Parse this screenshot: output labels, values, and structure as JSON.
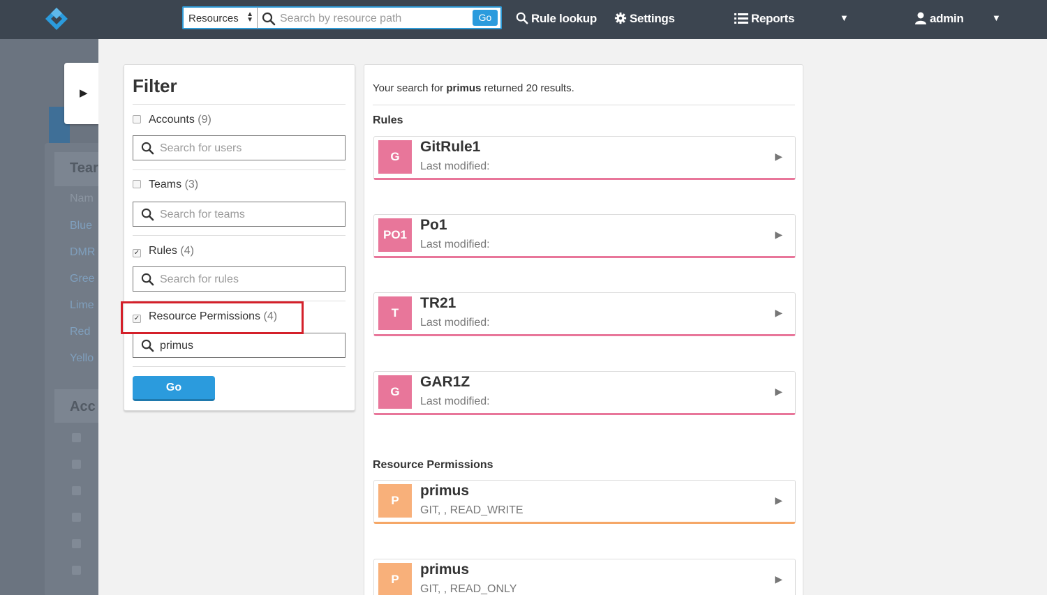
{
  "topbar": {
    "resource_select": "Resources",
    "search_placeholder": "Search by resource path",
    "go_label": "Go",
    "rule_lookup": "Rule lookup",
    "settings": "Settings",
    "reports": "Reports",
    "user": "admin"
  },
  "background": {
    "headings": [
      "Tear",
      "Acc"
    ],
    "name_col": "Nam",
    "teams": [
      "Blue",
      "DMR",
      "Gree",
      "Lime",
      "Red",
      "Yello"
    ]
  },
  "filter": {
    "title": "Filter",
    "sections": [
      {
        "label": "Accounts",
        "count": "(9)",
        "checked": false,
        "placeholder": "Search for users",
        "value": ""
      },
      {
        "label": "Teams",
        "count": "(3)",
        "checked": false,
        "placeholder": "Search for teams",
        "value": ""
      },
      {
        "label": "Rules",
        "count": "(4)",
        "checked": true,
        "placeholder": "Search for rules",
        "value": ""
      },
      {
        "label": "Resource Permissions",
        "count": "(4)",
        "checked": true,
        "placeholder": "",
        "value": "primus"
      }
    ],
    "go_label": "Go"
  },
  "results": {
    "summary_prefix": "Your search for",
    "query": "primus",
    "summary_suffix": "returned 20 results.",
    "rules_heading": "Rules",
    "rules": [
      {
        "badge": "G",
        "title": "GitRule1",
        "subtitle": "Last modified:"
      },
      {
        "badge": "PO1",
        "title": "Po1",
        "subtitle": "Last modified:"
      },
      {
        "badge": "T",
        "title": "TR21",
        "subtitle": "Last modified:"
      },
      {
        "badge": "G",
        "title": "GAR1Z",
        "subtitle": "Last modified:"
      }
    ],
    "perms_heading": "Resource Permissions",
    "permissions": [
      {
        "badge": "P",
        "title": "primus",
        "subtitle": "GIT, , READ_WRITE"
      },
      {
        "badge": "P",
        "title": "primus",
        "subtitle": "GIT, , READ_ONLY"
      }
    ]
  },
  "colors": {
    "topbar": "#3c4550",
    "accent": "#2b9bdd",
    "rule_badge": "#e8769a",
    "perm_badge": "#f8b07a",
    "highlight": "#d4202a"
  }
}
